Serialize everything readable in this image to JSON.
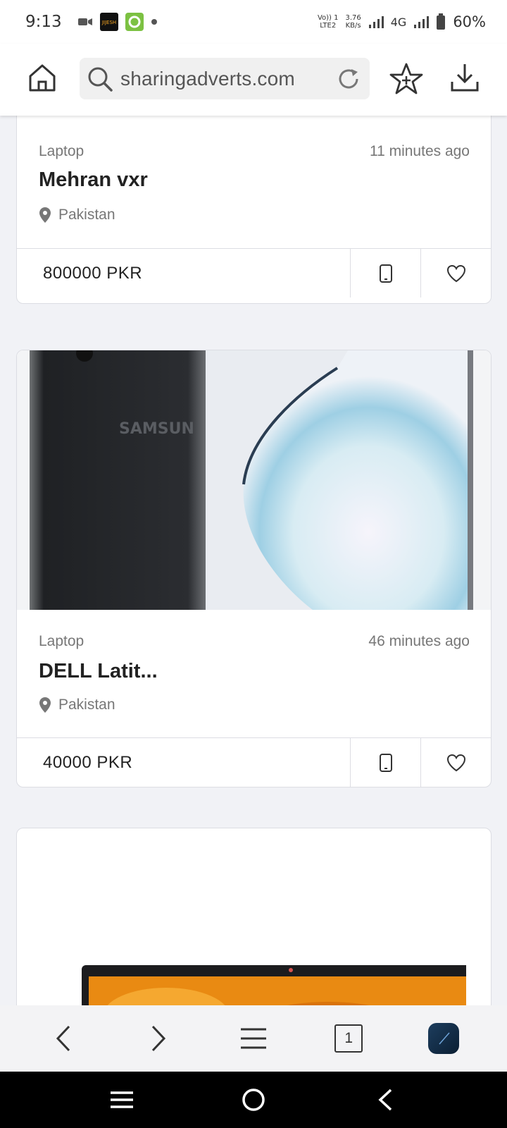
{
  "status_bar": {
    "time": "9:13",
    "network_top": "Vo)) 1",
    "network_bottom": "LTE2",
    "speed_value": "3.76",
    "speed_unit": "KB/s",
    "network_type": "4G",
    "battery": "60%"
  },
  "browser": {
    "url": "sharingadverts.com",
    "icons": [
      "home-icon",
      "search-icon",
      "reload-icon",
      "add-bookmark-star-icon",
      "download-icon"
    ]
  },
  "listings": [
    {
      "category": "Laptop",
      "time_ago": "11 minutes ago",
      "title": "Mehran vxr",
      "location": "Pakistan",
      "price": "800000 PKR"
    },
    {
      "category": "Laptop",
      "time_ago": "46 minutes ago",
      "title": "DELL Latit...",
      "location": "Pakistan",
      "price": "40000 PKR",
      "image_text": "SAMSUN"
    },
    {
      "category": "",
      "title": ""
    }
  ],
  "bottom_nav": {
    "tab_count": "1",
    "icons": [
      "back-icon",
      "forward-icon",
      "menu-icon",
      "tabs-icon",
      "profile-icon"
    ]
  },
  "system_nav": {
    "icons": [
      "recents-icon",
      "home-circle-icon",
      "system-back-icon"
    ]
  },
  "colors": {
    "page_background": "#f1f2f6",
    "card_border": "#dcdde3",
    "text_primary": "#222222",
    "text_secondary": "#777777"
  }
}
